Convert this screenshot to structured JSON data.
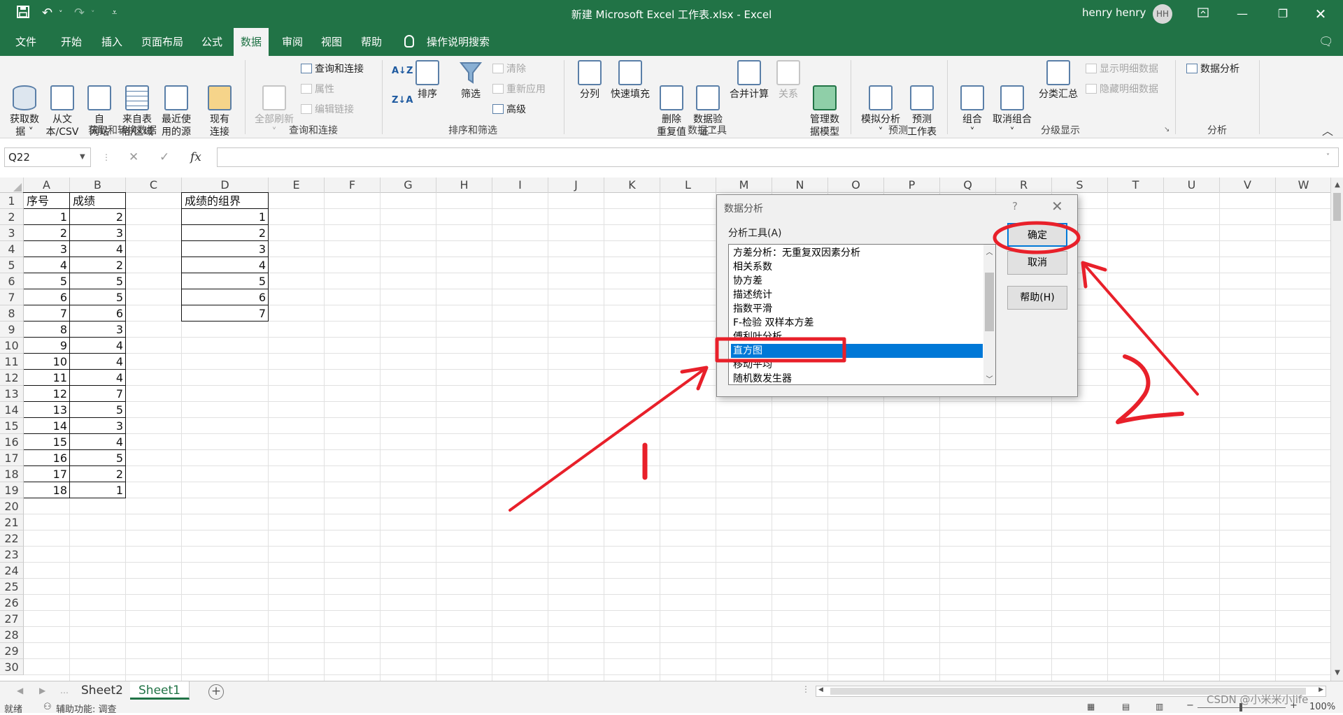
{
  "app": {
    "title": "新建 Microsoft Excel 工作表.xlsx  -  Excel",
    "user": "henry henry",
    "avatar": "HH",
    "accent": "#217346"
  },
  "tabs": [
    {
      "label": "文件"
    },
    {
      "label": "开始"
    },
    {
      "label": "插入"
    },
    {
      "label": "页面布局"
    },
    {
      "label": "公式"
    },
    {
      "label": "数据",
      "active": true
    },
    {
      "label": "审阅"
    },
    {
      "label": "视图"
    },
    {
      "label": "帮助"
    }
  ],
  "tell_me": "操作说明搜索",
  "ribbon": {
    "get_data": {
      "label": "获取和转换数据",
      "get_data_btn": "获取数\n据 ˅",
      "from_csv": "从文\n本/CSV",
      "from_web": "自\n网站",
      "from_table": "来自表\n格/区域",
      "recent_sources": "最近使\n用的源",
      "existing_conn": "现有\n连接"
    },
    "queries": {
      "label": "查询和连接",
      "refresh_all": "全部刷新\n˅",
      "queries_conn": "查询和连接",
      "properties": "属性",
      "edit_links": "编辑链接"
    },
    "sort_filter": {
      "label": "排序和筛选",
      "sort": "排序",
      "filter": "筛选",
      "clear": "清除",
      "reapply": "重新应用",
      "advanced": "高级"
    },
    "data_tools": {
      "label": "数据工具",
      "text_to_columns": "分列",
      "flash_fill": "快速填充",
      "remove_duplicates": "删除\n重复值",
      "validation": "数据验\n证 ˅",
      "consolidate": "合并计算",
      "relationships": "关系",
      "data_model": "管理数\n据模型"
    },
    "forecast": {
      "label": "预测",
      "what_if": "模拟分析\n˅",
      "forecast_sheet": "预测\n工作表"
    },
    "outline": {
      "label": "分级显示",
      "group": "组合\n˅",
      "ungroup": "取消组合\n˅",
      "subtotal": "分类汇总",
      "show_detail": "显示明细数据",
      "hide_detail": "隐藏明细数据"
    },
    "analysis": {
      "label": "分析",
      "data_analysis": "数据分析"
    }
  },
  "formula_bar": {
    "name_box": "Q22",
    "fx": "fx",
    "value": ""
  },
  "columns": [
    "A",
    "B",
    "C",
    "D",
    "E",
    "F",
    "G",
    "H",
    "I",
    "J",
    "K",
    "L",
    "M",
    "N",
    "O",
    "P",
    "Q",
    "R",
    "S",
    "T",
    "U",
    "V",
    "W"
  ],
  "rows": [
    "1",
    "2",
    "3",
    "4",
    "5",
    "6",
    "7",
    "8",
    "9",
    "10",
    "11",
    "12",
    "13",
    "14",
    "15",
    "16",
    "17",
    "18",
    "19",
    "20",
    "21",
    "22",
    "23",
    "24",
    "25",
    "26",
    "27",
    "28",
    "29",
    "30"
  ],
  "sheet": {
    "header_a": "序号",
    "header_b": "成绩",
    "header_d": "成绩的组界",
    "col_a": [
      "1",
      "2",
      "3",
      "4",
      "5",
      "6",
      "7",
      "8",
      "9",
      "10",
      "11",
      "12",
      "13",
      "14",
      "15",
      "16",
      "17",
      "18"
    ],
    "col_b": [
      "2",
      "3",
      "4",
      "2",
      "5",
      "5",
      "6",
      "3",
      "4",
      "4",
      "4",
      "7",
      "5",
      "3",
      "4",
      "5",
      "2",
      "1"
    ],
    "col_d": [
      "1",
      "2",
      "3",
      "4",
      "5",
      "6",
      "7"
    ]
  },
  "dialog": {
    "title": "数据分析",
    "help_glyph": "?",
    "list_label": "分析工具(A)",
    "items": [
      "方差分析：无重复双因素分析",
      "相关系数",
      "协方差",
      "描述统计",
      "指数平滑",
      "F-检验 双样本方差",
      "傅利叶分析",
      "直方图",
      "移动平均",
      "随机数发生器"
    ],
    "selected_index": 7,
    "ok": "确定",
    "cancel": "取消",
    "help": "帮助(H)"
  },
  "sheet_tabs": [
    {
      "label": "Sheet2"
    },
    {
      "label": "Sheet1",
      "active": true
    }
  ],
  "status": {
    "ready": "就绪",
    "accessibility": "辅助功能: 调查",
    "zoom": "100%"
  },
  "annotations": {
    "step1": "1",
    "step2": "2",
    "color": "#e8202a"
  },
  "watermark": "CSDN @小米米小life"
}
